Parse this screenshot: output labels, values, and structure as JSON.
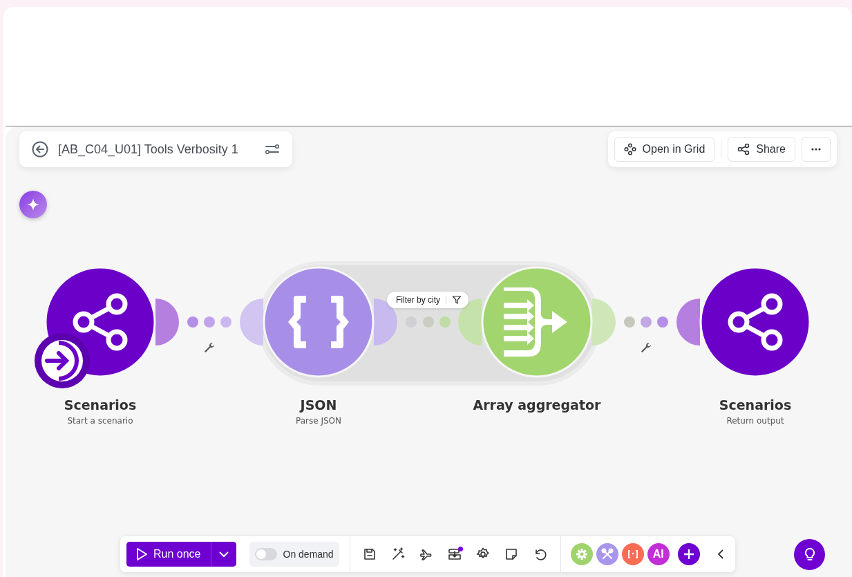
{
  "header": {
    "title": "[AB_C04_U01] Tools Verbosity 1"
  },
  "actions": [
    {
      "label": "Open in Grid"
    },
    {
      "label": "Share"
    }
  ],
  "nodes": [
    {
      "kind": "share",
      "app": "Scenarios",
      "subtitle": "Start a scenario",
      "color": "#6b00c9",
      "trigger": true
    },
    {
      "kind": "json",
      "app": "JSON",
      "subtitle": "Parse JSON",
      "color": "#a78fe8",
      "trigger": false
    },
    {
      "kind": "aggregator",
      "app": "Array aggregator",
      "color": "#a2d56e",
      "trigger": false
    },
    {
      "kind": "share",
      "app": "Scenarios",
      "subtitle": "Return output",
      "color": "#6b00c9",
      "trigger": false
    }
  ],
  "filter": {
    "label": "Filter by city"
  },
  "toolbar": {
    "run": {
      "label": "Run once"
    },
    "schedule": {
      "label": "On demand",
      "on": false
    },
    "apps": [
      {
        "kind": "gear",
        "color": "#9fd36b"
      },
      {
        "kind": "tools",
        "color": "#a995ec"
      },
      {
        "kind": "brackets",
        "color": "#fa6d55"
      },
      {
        "kind": "text",
        "label": "AI",
        "color": "#c32fd6"
      }
    ]
  }
}
